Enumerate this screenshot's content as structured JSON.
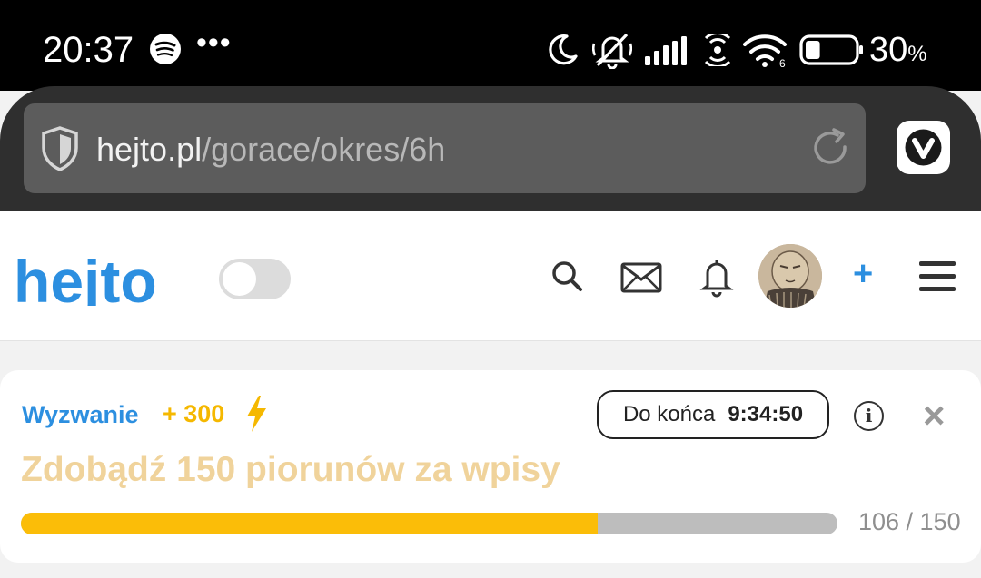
{
  "status_bar": {
    "time": "20:37",
    "overflow": "•••",
    "battery_percent": "30",
    "battery_unit": "%",
    "battery_level": 0.3,
    "icons": [
      "spotify-icon",
      "moon-icon",
      "mute-icon",
      "signal-icon",
      "hotspot-icon",
      "wifi-icon",
      "battery-icon"
    ]
  },
  "browser": {
    "url_domain": "hejto.pl",
    "url_path": "/gorace/okres/6h",
    "icons": [
      "shield-icon",
      "reload-icon",
      "vivaldi-icon"
    ]
  },
  "site_header": {
    "logo_text": "hejto",
    "plus_label": "+",
    "icons": [
      "search-icon",
      "mail-icon",
      "bell-icon",
      "menu-icon"
    ],
    "brand_color": "#2c8fe0"
  },
  "challenge": {
    "label": "Wyzwanie",
    "points": "+ 300",
    "timer_label": "Do końca",
    "timer_value": "9:34:50",
    "info": "i",
    "close": "×",
    "title": "Zdobądź 150 piorunów za wpisy",
    "progress_text": "106 / 150",
    "progress_current": 106,
    "progress_total": 150,
    "progress_fraction": 0.7067,
    "accent_color": "#fbbd08"
  }
}
